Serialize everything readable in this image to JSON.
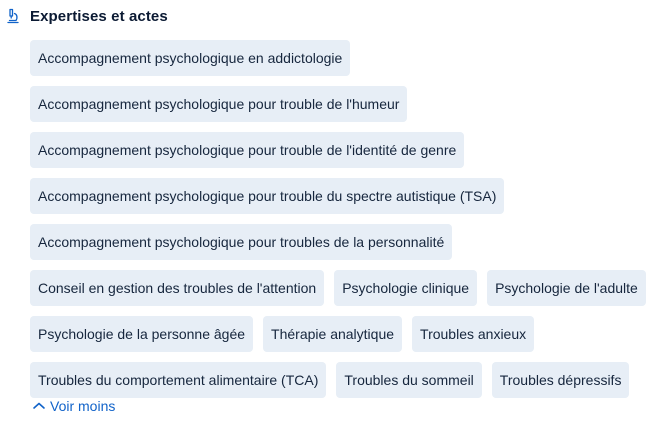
{
  "section": {
    "icon": "microscope-icon",
    "title": "Expertises et actes"
  },
  "chips": [
    [
      "Accompagnement psychologique en addictologie"
    ],
    [
      "Accompagnement psychologique pour trouble de l'humeur"
    ],
    [
      "Accompagnement psychologique pour trouble de l'identité de genre"
    ],
    [
      "Accompagnement psychologique pour trouble du spectre autistique (TSA)"
    ],
    [
      "Accompagnement psychologique pour troubles de la personnalité"
    ],
    [
      "Conseil en gestion des troubles de l'attention",
      "Psychologie clinique",
      "Psychologie de l'adulte"
    ],
    [
      "Psychologie de la personne âgée",
      "Thérapie analytique",
      "Troubles anxieux"
    ],
    [
      "Troubles du comportement alimentaire (TCA)",
      "Troubles du sommeil",
      "Troubles dépressifs"
    ]
  ],
  "toggle": {
    "label": "Voir moins",
    "icon": "chevron-up-icon"
  },
  "colors": {
    "chip_bg": "#e7eef6",
    "link": "#1163c9",
    "text": "#0b1a33"
  }
}
